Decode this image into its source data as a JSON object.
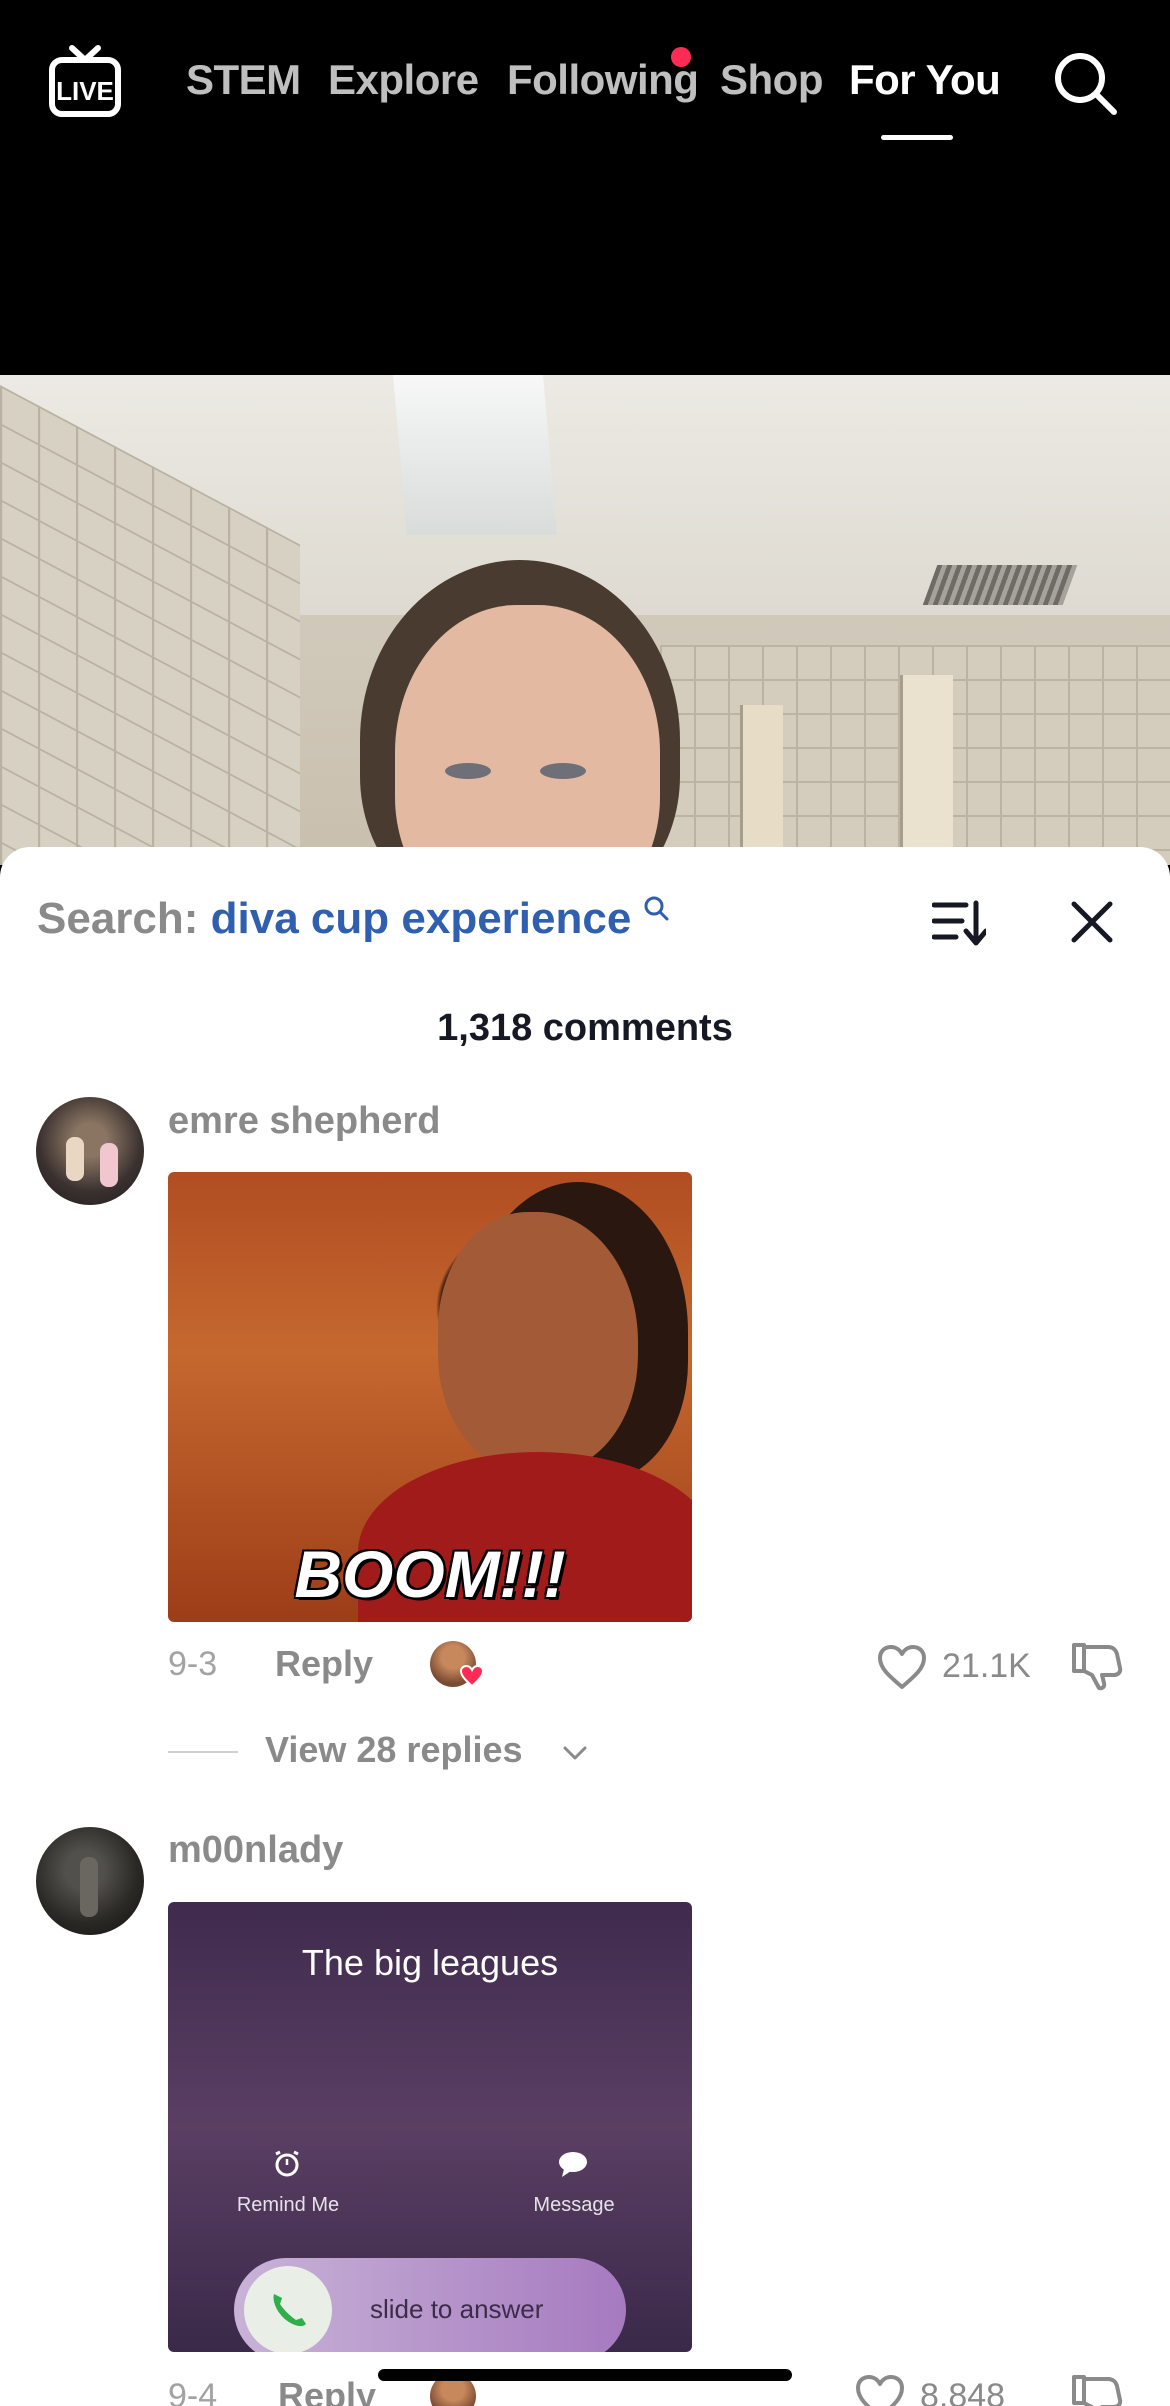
{
  "top_nav": {
    "live_icon": "live-tv-icon",
    "tabs": [
      {
        "label": "STEM"
      },
      {
        "label": "Explore"
      },
      {
        "label": "Following"
      },
      {
        "label": "Shop"
      },
      {
        "label": "For You"
      }
    ],
    "active_tab": "For You",
    "search_icon": "search-icon"
  },
  "video": {
    "description": "bathroom selfie"
  },
  "comments_sheet": {
    "search_label": "Search:",
    "search_query": "diva cup experience",
    "sort_icon": "sort-icon",
    "close_icon": "close-icon",
    "comment_count": "1,318 comments",
    "comments": [
      {
        "username": "emre shepherd",
        "gif_text": "BOOM!!!",
        "date": "9-3",
        "reply_label": "Reply",
        "likes": "21.1K",
        "view_replies": "View 28 replies"
      },
      {
        "username": "m00nlady",
        "gif_title": "The big leagues",
        "gif_left_label": "Remind Me",
        "gif_right_label": "Message",
        "gif_slider_text": "slide to answer",
        "date": "9-4",
        "reply_label": "Reply",
        "likes": "8,848"
      }
    ]
  },
  "colors": {
    "accent_red": "#fe2c55",
    "query_blue": "#2f5fae",
    "muted_text": "#8a8a8a"
  }
}
